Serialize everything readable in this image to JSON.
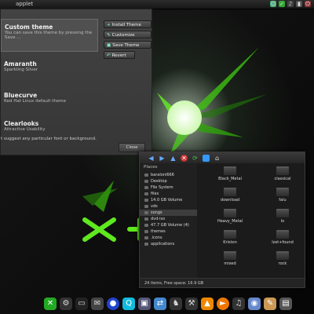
{
  "top_panel": {
    "title": "applet",
    "tray_icons": [
      "chat-icon",
      "network-icon",
      "volume-icon",
      "battery-icon",
      "power-icon"
    ]
  },
  "appearance_dialog": {
    "themes": [
      {
        "name": "Custom theme",
        "description": "You can save this theme by pressing the Save ..."
      },
      {
        "name": "Amaranth",
        "description": "Sparkling Silver"
      },
      {
        "name": "Bluecurve",
        "description": "Red Hat Linux default theme"
      },
      {
        "name": "Clearlooks",
        "description": "Attractive Usability"
      }
    ],
    "buttons": {
      "install": "Install Theme",
      "customize": "Customize",
      "save": "Save Theme",
      "revert": "Revert"
    },
    "hint_text": "t suggest any particular font or background.",
    "close_label": "Close"
  },
  "file_manager": {
    "toolbar_icons": [
      "back-icon",
      "forward-icon",
      "up-icon",
      "stop-icon",
      "reload-icon",
      "computer-icon",
      "home-icon"
    ],
    "places_label": "Places",
    "places": [
      "baraloni666",
      "Desktop",
      "File System",
      "files",
      "14.0 GB Volume",
      "vds",
      "songs",
      "dvd-iso",
      "47.7 GB Volume (4)",
      "themes",
      ".icons",
      "applications"
    ],
    "selected_place": "songs",
    "folders": [
      "Black_Metal",
      "classical",
      "download",
      "falu",
      "Heavy_Metal",
      "lo",
      "Kriston",
      "lost+found",
      "mixed",
      "rock"
    ],
    "status": "24 items, Free space: 16.9 GB"
  },
  "dock": {
    "icons": [
      "xfce-icon",
      "settings-icon",
      "terminal-icon",
      "mail-icon",
      "browser-icon",
      "quake-icon",
      "monitor-icon",
      "network-icon",
      "game-icon",
      "tools-icon",
      "vlc-icon",
      "player-icon",
      "music-icon",
      "eye-icon",
      "notes-icon",
      "extra-icon"
    ]
  },
  "colors": {
    "accent_green": "#57e617",
    "panel_bg": "#3c3c3c",
    "fm_bg": "#1b1b1b"
  }
}
